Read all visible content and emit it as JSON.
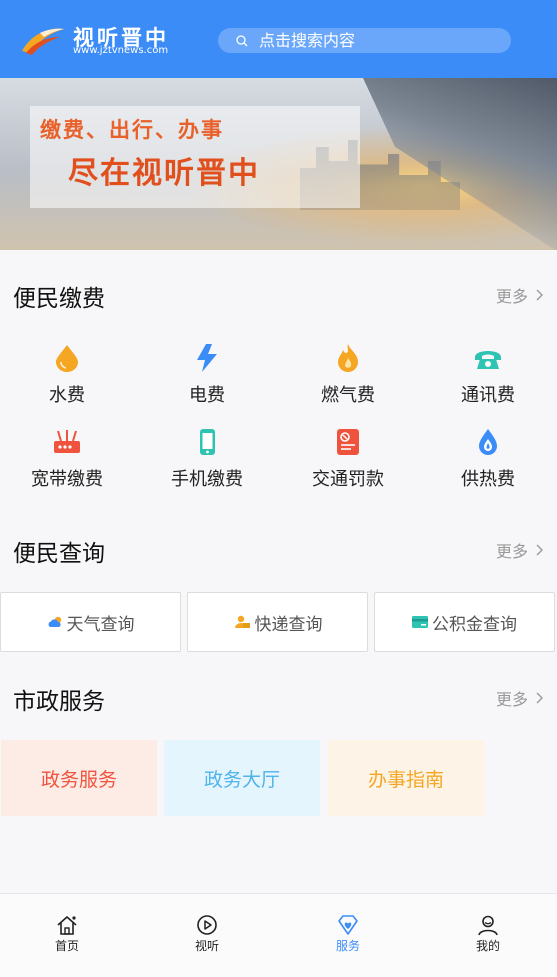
{
  "header": {
    "logo_cn": "视听晋中",
    "logo_url": "www.jztvnews.com",
    "search_placeholder": "点击搜索内容"
  },
  "banner": {
    "line1": "缴费、出行、办事",
    "line2": "尽在视听晋中"
  },
  "payments": {
    "title": "便民缴费",
    "more": "更多",
    "items": [
      {
        "label": "水费",
        "icon": "water-drop-icon",
        "color": "#f5a623"
      },
      {
        "label": "电费",
        "icon": "lightning-icon",
        "color": "#3c8cf7"
      },
      {
        "label": "燃气费",
        "icon": "flame-icon",
        "color": "#f5a623"
      },
      {
        "label": "通讯费",
        "icon": "telephone-icon",
        "color": "#2fc3b4"
      },
      {
        "label": "宽带缴费",
        "icon": "router-icon",
        "color": "#f0533d"
      },
      {
        "label": "手机缴费",
        "icon": "mobile-phone-icon",
        "color": "#2fc3b4"
      },
      {
        "label": "交通罚款",
        "icon": "ticket-icon",
        "color": "#f0533d"
      },
      {
        "label": "供热费",
        "icon": "heat-drop-icon",
        "color": "#3c8cf7"
      }
    ]
  },
  "queries": {
    "title": "便民查询",
    "more": "更多",
    "items": [
      {
        "label": "天气查询",
        "icon": "weather-icon"
      },
      {
        "label": "快递查询",
        "icon": "courier-icon"
      },
      {
        "label": "公积金查询",
        "icon": "card-icon"
      }
    ]
  },
  "municipal": {
    "title": "市政服务",
    "more": "更多",
    "items": [
      {
        "label": "政务服务",
        "bg": "#fdece6",
        "color": "#f0533d"
      },
      {
        "label": "政务大厅",
        "bg": "#e5f5fd",
        "color": "#4fb3ec"
      },
      {
        "label": "办事指南",
        "bg": "#fdf3e6",
        "color": "#f5a623"
      }
    ]
  },
  "tabbar": {
    "items": [
      {
        "label": "首页",
        "icon": "home-icon"
      },
      {
        "label": "视听",
        "icon": "play-icon"
      },
      {
        "label": "服务",
        "icon": "diamond-heart-icon",
        "active": true
      },
      {
        "label": "我的",
        "icon": "user-icon"
      }
    ]
  },
  "colors": {
    "brand": "#3c8cf7",
    "page_bg": "#f7f7f9"
  }
}
